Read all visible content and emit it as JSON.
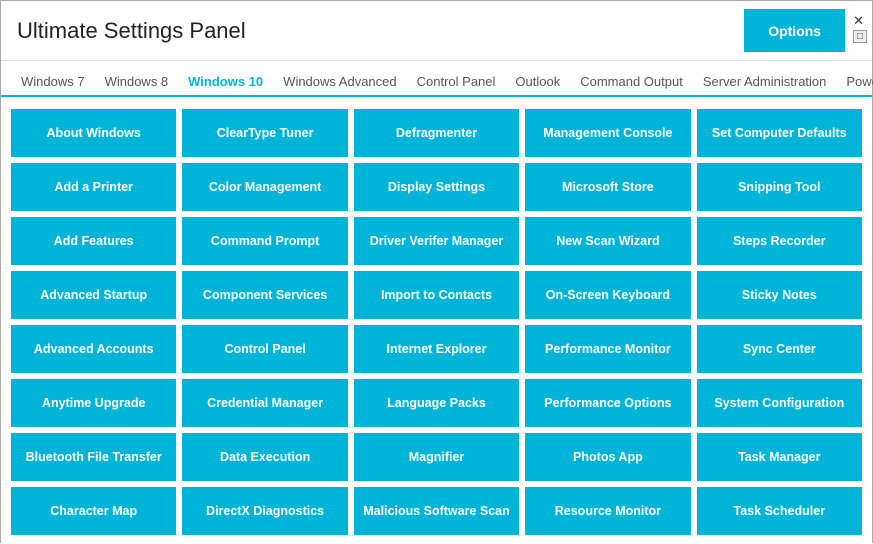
{
  "header": {
    "title": "Ultimate Settings Panel",
    "options_label": "Options"
  },
  "window_controls": {
    "minimize": "—",
    "maximize": "□",
    "close": "✕"
  },
  "tabs": [
    {
      "label": "Windows 7",
      "active": false
    },
    {
      "label": "Windows 8",
      "active": false
    },
    {
      "label": "Windows 10",
      "active": true
    },
    {
      "label": "Windows Advanced",
      "active": false
    },
    {
      "label": "Control Panel",
      "active": false
    },
    {
      "label": "Outlook",
      "active": false
    },
    {
      "label": "Command Output",
      "active": false
    },
    {
      "label": "Server Administration",
      "active": false
    },
    {
      "label": "Powershell",
      "active": false
    }
  ],
  "tiles": [
    {
      "label": "About Windows"
    },
    {
      "label": "ClearType Tuner"
    },
    {
      "label": "Defragmenter"
    },
    {
      "label": "Management Console"
    },
    {
      "label": "Set Computer Defaults"
    },
    {
      "label": "Add a Printer"
    },
    {
      "label": "Color Management"
    },
    {
      "label": "Display Settings"
    },
    {
      "label": "Microsoft Store"
    },
    {
      "label": "Snipping Tool"
    },
    {
      "label": "Add Features"
    },
    {
      "label": "Command Prompt"
    },
    {
      "label": "Driver Verifer Manager"
    },
    {
      "label": "New Scan Wizard"
    },
    {
      "label": "Steps Recorder"
    },
    {
      "label": "Advanced Startup"
    },
    {
      "label": "Component Services"
    },
    {
      "label": "Import to Contacts"
    },
    {
      "label": "On-Screen Keyboard"
    },
    {
      "label": "Sticky Notes"
    },
    {
      "label": "Advanced Accounts"
    },
    {
      "label": "Control Panel"
    },
    {
      "label": "Internet Explorer"
    },
    {
      "label": "Performance Monitor"
    },
    {
      "label": "Sync Center"
    },
    {
      "label": "Anytime Upgrade"
    },
    {
      "label": "Credential Manager"
    },
    {
      "label": "Language Packs"
    },
    {
      "label": "Performance Options"
    },
    {
      "label": "System Configuration"
    },
    {
      "label": "Bluetooth File Transfer"
    },
    {
      "label": "Data Execution"
    },
    {
      "label": "Magnifier"
    },
    {
      "label": "Photos App"
    },
    {
      "label": "Task Manager"
    },
    {
      "label": "Character Map"
    },
    {
      "label": "DirectX Diagnostics"
    },
    {
      "label": "Malicious Software Scan"
    },
    {
      "label": "Resource Monitor"
    },
    {
      "label": "Task Scheduler"
    }
  ]
}
